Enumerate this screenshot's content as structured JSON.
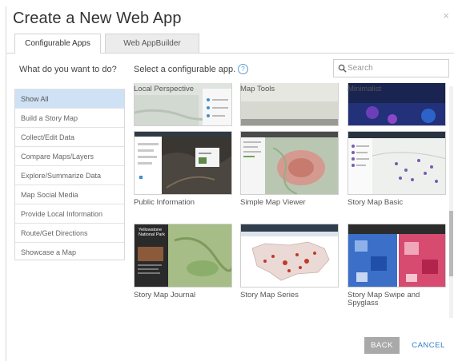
{
  "dialog": {
    "title": "Create a New Web App",
    "close_glyph": "×"
  },
  "tabs": [
    {
      "label": "Configurable Apps",
      "active": true
    },
    {
      "label": "Web AppBuilder",
      "active": false
    }
  ],
  "sidebar": {
    "question": "What do you want to do?",
    "items": [
      {
        "label": "Show All",
        "selected": true
      },
      {
        "label": "Build a Story Map",
        "selected": false
      },
      {
        "label": "Collect/Edit Data",
        "selected": false
      },
      {
        "label": "Compare Maps/Layers",
        "selected": false
      },
      {
        "label": "Explore/Summarize Data",
        "selected": false
      },
      {
        "label": "Map Social Media",
        "selected": false
      },
      {
        "label": "Provide Local Information",
        "selected": false
      },
      {
        "label": "Route/Get Directions",
        "selected": false
      },
      {
        "label": "Showcase a Map",
        "selected": false
      }
    ]
  },
  "main": {
    "prompt": "Select a configurable app.",
    "help_icon": "question-circle-icon",
    "search": {
      "placeholder": "Search",
      "value": ""
    },
    "apps": [
      {
        "label": "Local Perspective"
      },
      {
        "label": "Map Tools"
      },
      {
        "label": "Minimalist"
      },
      {
        "label": "Public Information"
      },
      {
        "label": "Simple Map Viewer"
      },
      {
        "label": "Story Map Basic"
      },
      {
        "label": "Story Map Journal",
        "thumb_title": "Yellowstone National Park"
      },
      {
        "label": "Story Map Series"
      },
      {
        "label": "Story Map Swipe and Spyglass"
      }
    ]
  },
  "footer": {
    "back_label": "BACK",
    "cancel_label": "CANCEL"
  },
  "colors": {
    "accent": "#2a7fc7",
    "selected_bg": "#cfe1f5",
    "back_button_bg": "#a9a9a9"
  }
}
